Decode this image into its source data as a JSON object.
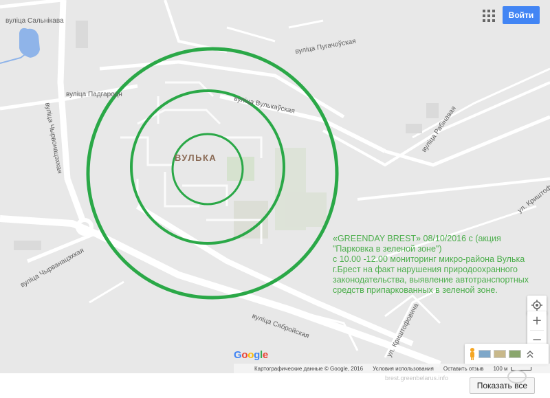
{
  "map": {
    "district_label": "ВУЛЬКА",
    "streets": [
      {
        "id": "salnikava",
        "label": "вуліца Сальнікава"
      },
      {
        "id": "pugachouskaya",
        "label": "вуліца Пугачоўская"
      },
      {
        "id": "padgarodnaya",
        "label": "вуліца Падгародн"
      },
      {
        "id": "vulkauskaya",
        "label": "вуліца Вулькаўская"
      },
      {
        "id": "chyrvonatsyarskaya",
        "label": "вуліца Чырвонацэхкая"
      },
      {
        "id": "rabinavaya",
        "label": "вуліца Рабінавая"
      },
      {
        "id": "krushtofovicha-east",
        "label": "ул. Криштоф"
      },
      {
        "id": "chyrvanatsyarskaya-sw",
        "label": "вуліца Чырванацэхкая"
      },
      {
        "id": "safroyuskaya",
        "label": "вуліца Сябройская"
      },
      {
        "id": "krushtofovicha-south",
        "label": "ул. Криштофовича"
      }
    ],
    "circles_color": "#2aa847"
  },
  "annotation": {
    "lines": [
      "«GREENDAY BREST» 08/10/2016 с  (акция",
      "\"Парковка в зеленой зоне\")",
      "с 10.00 -12.00 мониторинг микро-района Вулька",
      "г.Брест на факт нарушения природоохранного",
      "законодательства, выявление автотранспортных",
      "средств припаркованных в зеленой зоне."
    ],
    "color": "#4cae4c"
  },
  "header": {
    "apps_icon": "apps-grid-icon",
    "signin_label": "Войти"
  },
  "controls": {
    "locate_icon": "my-location-icon",
    "zoom_in_label": "+",
    "zoom_out_label": "−",
    "expand_icon": "chevron-up-double-icon"
  },
  "footer": {
    "copyright": "Картографические данные © Google, 2016",
    "terms": "Условия использования",
    "feedback": "Оставить отзыв",
    "scale_label": "100 м"
  },
  "logo": {
    "text": "Google"
  },
  "bottom": {
    "show_all_label": "Показать все",
    "watermark": "brest.greenbelarus.info"
  }
}
